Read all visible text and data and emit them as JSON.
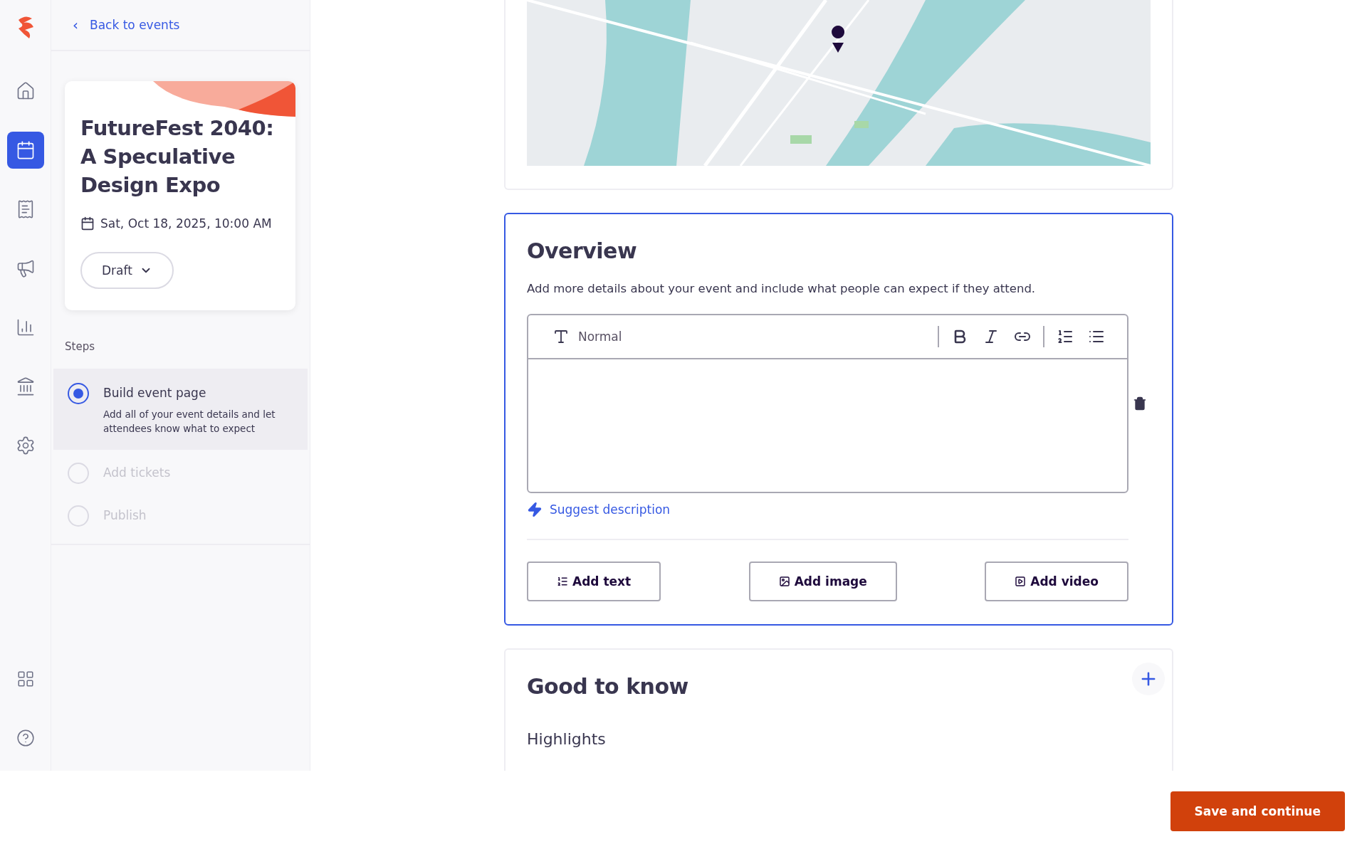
{
  "rail": [
    {
      "selected": false
    },
    {
      "selected": true
    },
    {
      "selected": false
    },
    {
      "selected": false
    },
    {
      "selected": false
    },
    {
      "selected": false
    },
    {
      "selected": false
    }
  ],
  "sidebar": {
    "back_link": "Back to events",
    "back_icon": "‹",
    "event": {
      "title": "FutureFest 2040: A Speculative Design Expo",
      "date": "Sat, Oct 18, 2025, 10:00 AM",
      "status": "Draft"
    },
    "steps_label": "Steps",
    "steps": [
      {
        "title": "Build event page",
        "description": "Add all of your event details and let attendees know what to expect",
        "selected": true,
        "disabled": false
      },
      {
        "title": "Add tickets",
        "selected": false,
        "disabled": true
      },
      {
        "title": "Publish",
        "selected": false,
        "disabled": true
      }
    ]
  },
  "overview": {
    "title": "Overview",
    "description": "Add more details about your event and include what people can expect if they attend.",
    "editor": {
      "style": "Normal"
    },
    "suggest": "Suggest description",
    "buttons": [
      "Add text",
      "Add image",
      "Add video"
    ]
  },
  "good_to_know": {
    "title": "Good to know",
    "subtitle": "Highlights"
  },
  "footer": {
    "save": "Save and continue"
  }
}
